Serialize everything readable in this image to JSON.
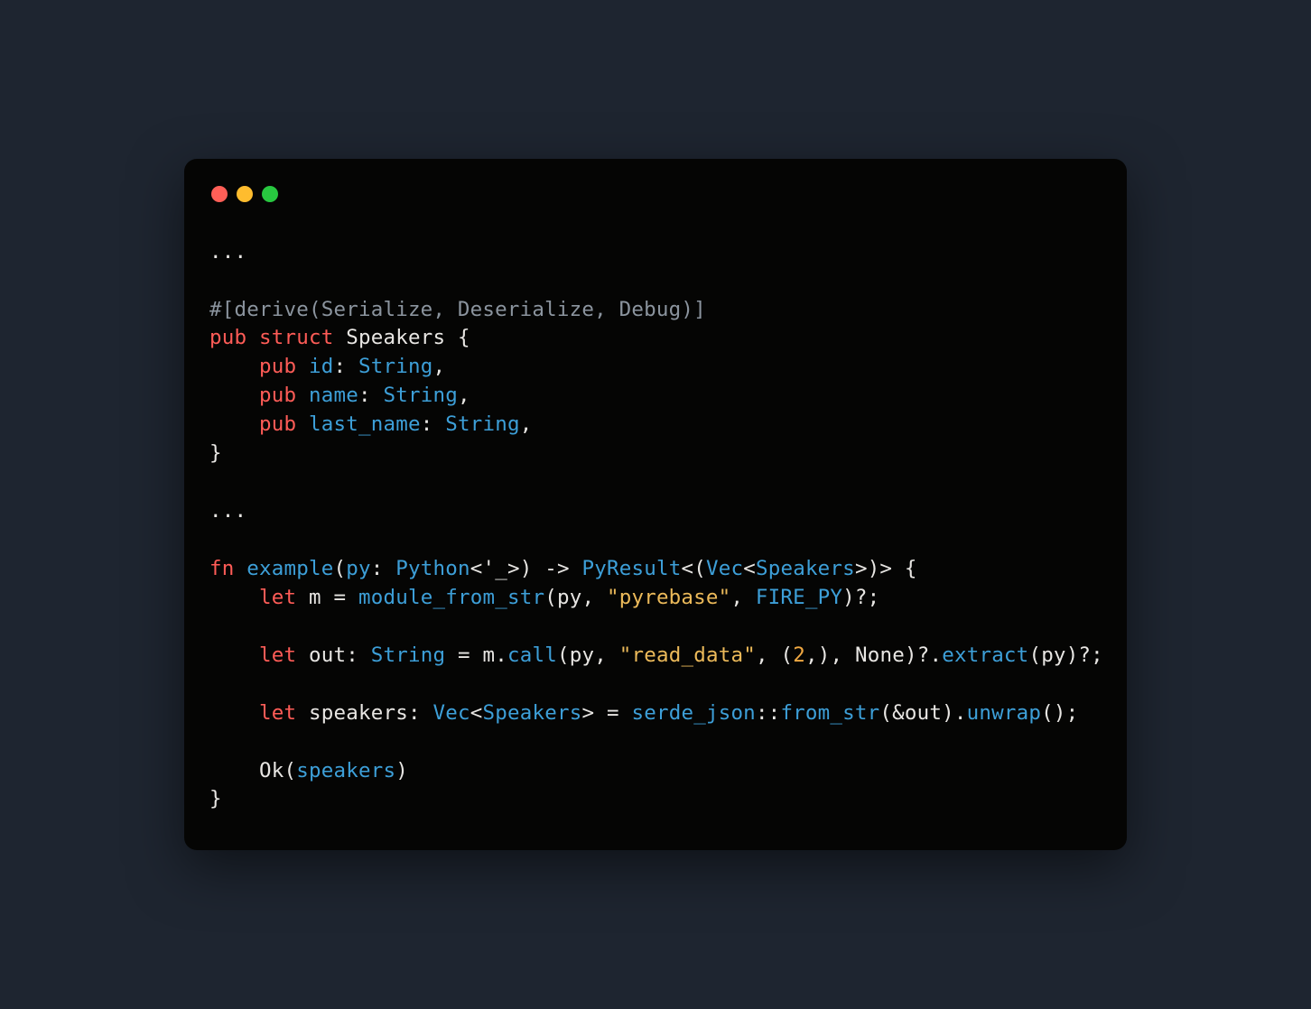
{
  "window": {
    "traffic": {
      "red": "#ff5f57",
      "yellow": "#febc2e",
      "green": "#28c840"
    }
  },
  "code": {
    "ellipsis1": "...",
    "derive_attr": "#[derive(Serialize, Deserialize, Debug)]",
    "pub": "pub",
    "struct": "struct",
    "struct_name": "Speakers",
    "lbrace": " {",
    "field_id_name": "id",
    "field_id_type": "String",
    "field_name_name": "name",
    "field_name_type": "String",
    "field_last_name": "last_name",
    "field_last_type": "String",
    "colon": ": ",
    "comma": ",",
    "rbrace": "}",
    "ellipsis2": "...",
    "fn": "fn",
    "fn_name": "example",
    "lparen": "(",
    "param_py": "py",
    "param_py_type": "Python",
    "lifetime": "<'_>",
    "rparen": ")",
    "arrow": " -> ",
    "ret_type_pyresult": "PyResult",
    "ret_lt": "<(",
    "ret_vec": "Vec",
    "ret_inner_lt": "<",
    "ret_speakers": "Speakers",
    "ret_inner_gt": ">",
    "ret_gt": ")>",
    "let": "let",
    "var_m": "m",
    "eq": " = ",
    "module_from_str": "module_from_str",
    "arg_py": "py",
    "str_pyrebase": "\"pyrebase\"",
    "fire_py": "FIRE_PY",
    "qmark_semi": ")?;",
    "var_out": "out",
    "out_type": "String",
    "m_dot": "m.",
    "call": "call",
    "str_read_data": "\"read_data\"",
    "tuple_open": "(",
    "num_2": "2",
    "tuple_close": ",)",
    "none": "None",
    "extract": "extract",
    "var_speakers": "speakers",
    "vec_type": "Vec",
    "speakers_type": "Speakers",
    "serde_json": "serde_json",
    "dcolon": "::",
    "from_str": "from_str",
    "amp": "&",
    "out_ref": "out",
    "unwrap": "unwrap",
    "empty_parens": "()",
    "semi": ";",
    "ok": "Ok",
    "speakers_var": "speakers",
    "indent": "    "
  }
}
